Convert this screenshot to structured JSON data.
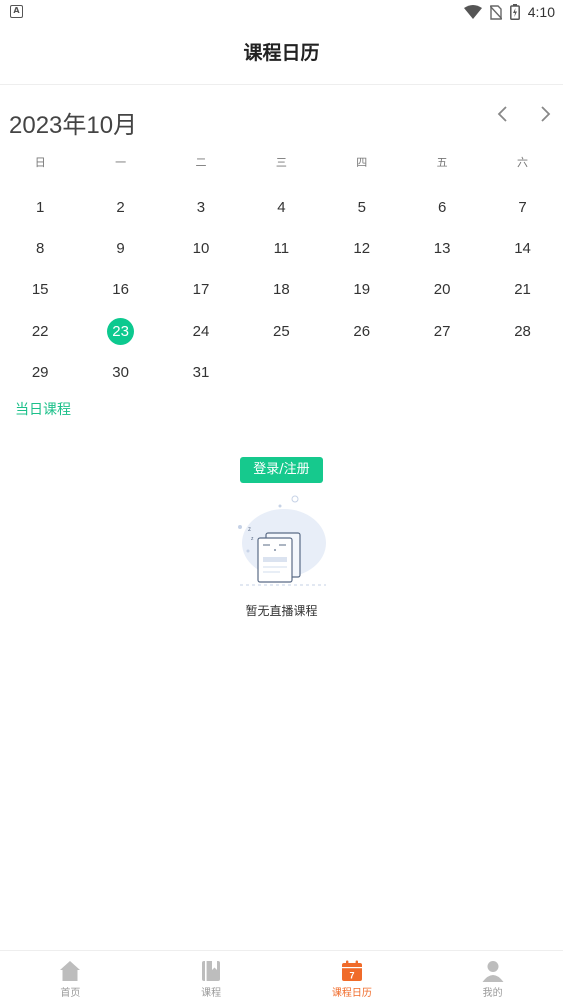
{
  "status_bar": {
    "time": "4:10",
    "badge": "A"
  },
  "header": {
    "title": "课程日历"
  },
  "calendar": {
    "month_title": "2023年10月",
    "weekdays": [
      "日",
      "一",
      "二",
      "三",
      "四",
      "五",
      "六"
    ],
    "days": [
      "1",
      "2",
      "3",
      "4",
      "5",
      "6",
      "7",
      "8",
      "9",
      "10",
      "11",
      "12",
      "13",
      "14",
      "15",
      "16",
      "17",
      "18",
      "19",
      "20",
      "21",
      "22",
      "23",
      "24",
      "25",
      "26",
      "27",
      "28",
      "29",
      "30",
      "31"
    ],
    "selected_day": "23",
    "accent_color": "#0cc98f"
  },
  "section": {
    "label": "当日课程"
  },
  "empty_state": {
    "login_button": "登录/注册",
    "message": "暂无直播课程"
  },
  "bottom_nav": {
    "items": [
      {
        "label": "首页",
        "icon": "home-icon"
      },
      {
        "label": "课程",
        "icon": "book-icon"
      },
      {
        "label": "课程日历",
        "icon": "calendar-icon",
        "active": true
      },
      {
        "label": "我的",
        "icon": "user-icon"
      }
    ],
    "active_color": "#f06b2a"
  }
}
